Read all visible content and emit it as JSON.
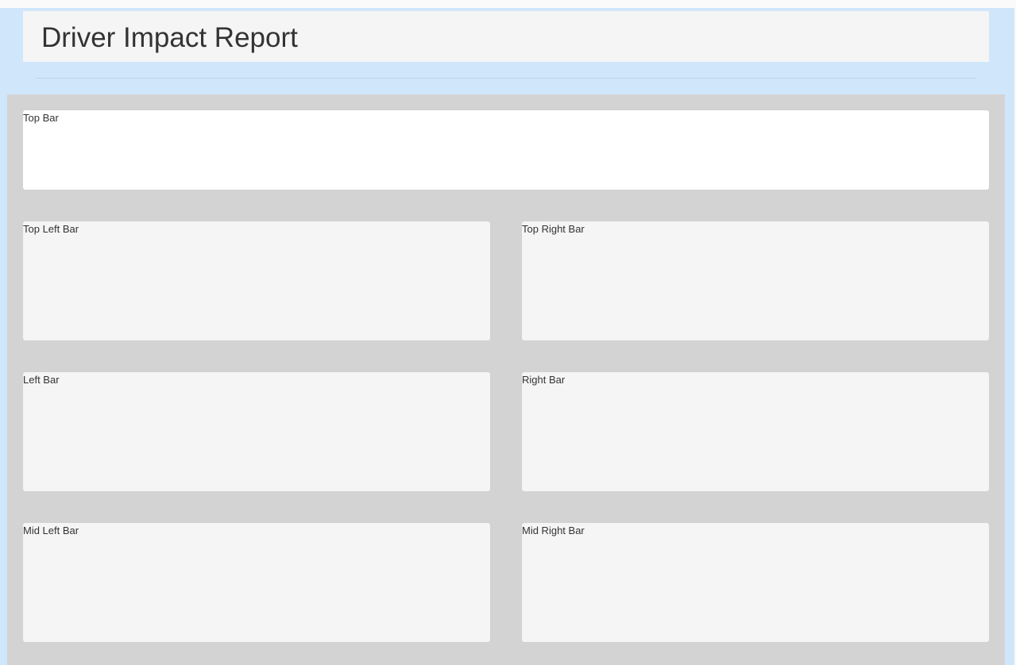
{
  "header": {
    "title": "Driver Impact Report"
  },
  "cards": {
    "top": "Top Bar",
    "top_left": "Top Left Bar",
    "top_right": "Top Right Bar",
    "left": "Left Bar",
    "right": "Right Bar",
    "mid_left": "Mid Left Bar",
    "mid_right": "Mid Right Bar"
  },
  "colors": {
    "frame_background": "#d0e6fb",
    "content_background": "#d3d3d3",
    "card_background": "#f5f5f5",
    "top_card_background": "#ffffff",
    "text": "#333333"
  }
}
